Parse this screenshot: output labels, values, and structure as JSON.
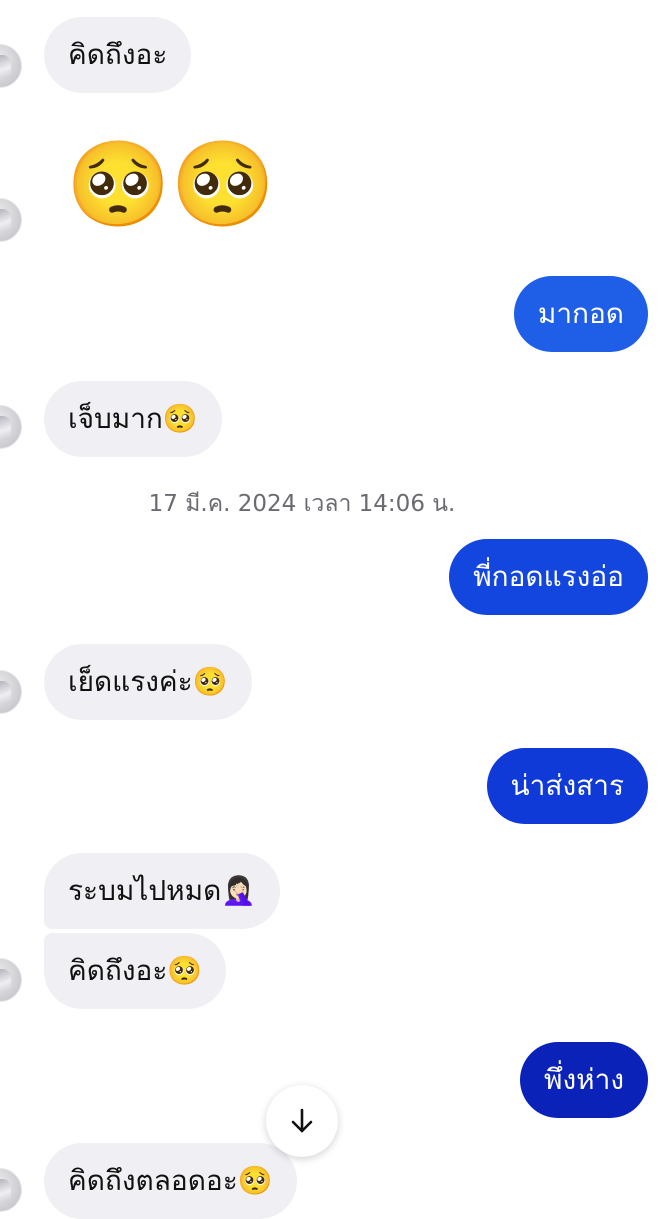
{
  "messages": [
    {
      "text": "คิดถึงอะ"
    },
    {
      "text": "🥺🥺"
    },
    {
      "text": "มากอด"
    },
    {
      "text": "เจ็บมาก🥺"
    },
    {
      "text": "พี่กอดแรงอ่อ"
    },
    {
      "text": "เย็ดแรงค่ะ🥺"
    },
    {
      "text": "น่าส่งสาร"
    },
    {
      "text": "ระบมไปหมด🤦🏻‍♀️"
    },
    {
      "text": "คิดถึงอะ🥺"
    },
    {
      "text": "พึ่งห่าง"
    },
    {
      "text": "คิดถึงตลอดอะ🥺"
    }
  ],
  "timestamp": "17 มี.ค. 2024 เวลา 14:06 น.",
  "colors": {
    "incoming_bubble": "#f0f0f4",
    "outgoing_gradient": [
      "#1f5fe8",
      "#1346df",
      "#0f3ad8",
      "#0c33cc",
      "#0a22b8"
    ]
  },
  "icons": {
    "scroll_down": "arrow-down-icon",
    "avatar": "contact-avatar"
  }
}
